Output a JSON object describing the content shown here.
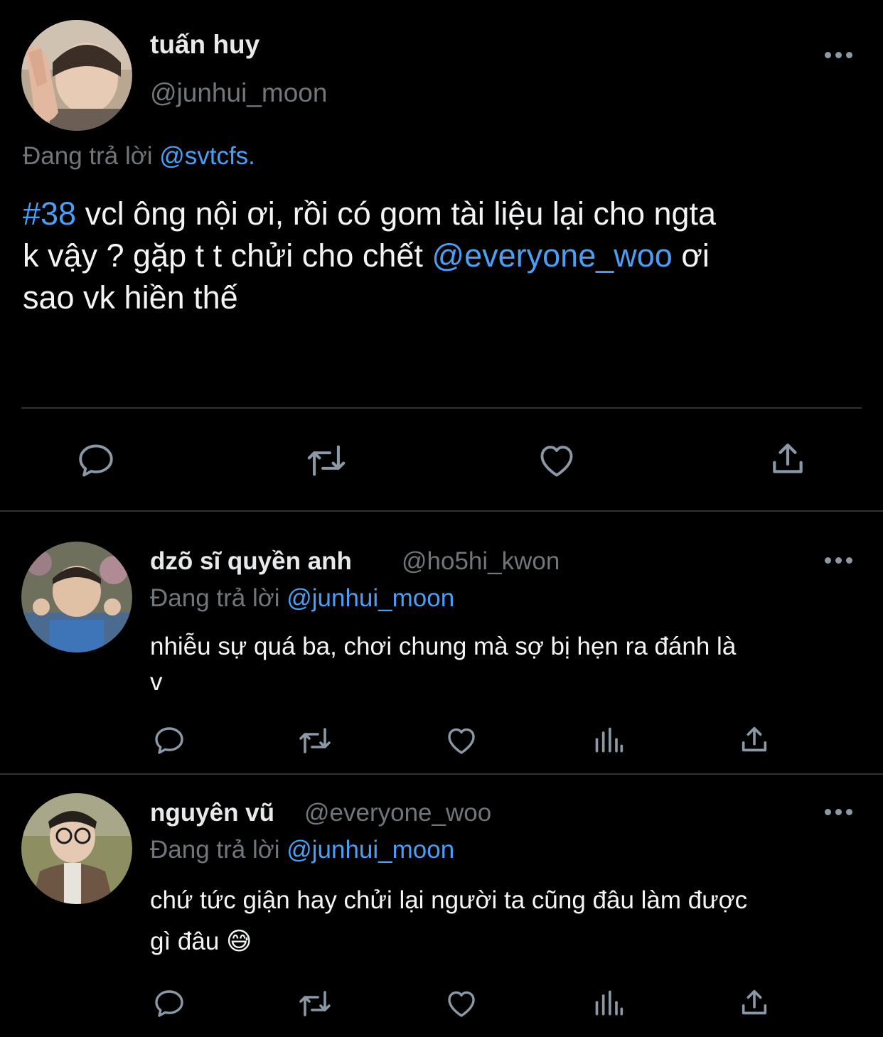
{
  "main_tweet": {
    "display_name": "tuấn huy",
    "handle": "@junhui_moon",
    "replying_label": "Đang trả lời",
    "replying_to": "@svtcfs.",
    "text_line1_hashtag": "#38",
    "text_line1_rest": " vcl ông nội ơi, rồi có gom tài liệu lại cho ngta",
    "text_line2_start": "k vậy ? gặp t t chửi cho chết ",
    "text_line2_mention": "@everyone_woo",
    "text_line2_end": " ơi",
    "text_line3": "sao vk hiền thế",
    "actions": [
      "reply-icon",
      "retweet-icon",
      "like-icon",
      "share-icon"
    ]
  },
  "replies": [
    {
      "display_name": "dzõ sĩ quyền anh",
      "handle": "@ho5hi_kwon",
      "replying_label": "Đang trả lời",
      "replying_to": "@junhui_moon",
      "text_line1": "nhiễu sự quá ba, chơi chung mà sợ bị hẹn ra đánh là",
      "text_line2": "v",
      "actions": [
        "reply-icon",
        "retweet-icon",
        "like-icon",
        "analytics-icon",
        "share-icon"
      ]
    },
    {
      "display_name": "nguyên vũ",
      "handle": "@everyone_woo",
      "replying_label": "Đang trả lời",
      "replying_to": "@junhui_moon",
      "text_line1": "chứ tức giận hay chửi lại người ta cũng đâu làm được",
      "text_line2": "gì đâu",
      "emoji": "😅",
      "actions": [
        "reply-icon",
        "retweet-icon",
        "like-icon",
        "analytics-icon",
        "share-icon"
      ]
    }
  ],
  "colors": {
    "background": "#000000",
    "text": "#e7e9ea",
    "muted": "#71767b",
    "link": "#4a9ff5",
    "icon": "#8b98a5",
    "divider": "#2f3336"
  }
}
